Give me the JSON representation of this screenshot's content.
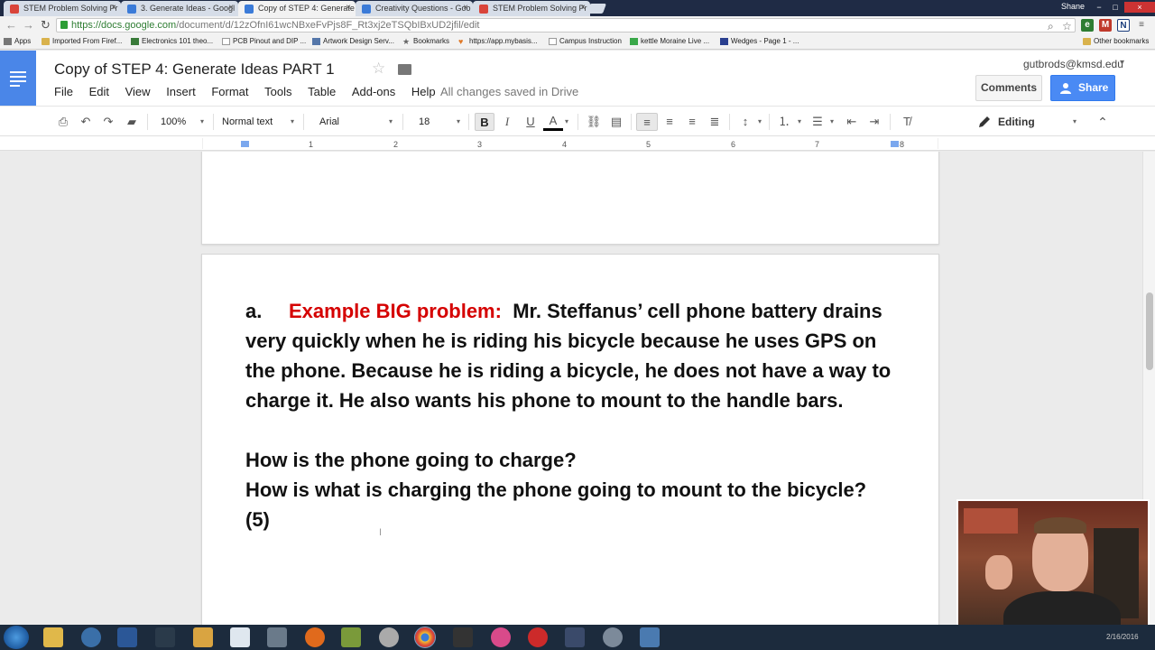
{
  "browser": {
    "tabs": [
      {
        "title": "STEM Problem Solving Pr",
        "active": false
      },
      {
        "title": "3. Generate Ideas - Googl",
        "active": false
      },
      {
        "title": "Copy of STEP 4: Generate",
        "active": true
      },
      {
        "title": "Creativity Questions - Goo",
        "active": false
      },
      {
        "title": "STEM Problem Solving Pr",
        "active": false
      }
    ],
    "profile_name": "Shane",
    "url_host": "https://docs.google.com",
    "url_path": "/document/d/12zOfnI61wcNBxeFvPjs8F_Rt3xj2eTSQbIBxUD2jfil/edit",
    "bookmarks": [
      "Apps",
      "Imported From Firef...",
      "Electronics 101 theo...",
      "PCB Pinout and DIP ...",
      "Artwork Design Serv...",
      "Bookmarks",
      "https://app.mybasis...",
      "Campus Instruction",
      "kettle Moraine Live ...",
      "Wedges - Page 1 - ..."
    ],
    "other_bookmarks": "Other bookmarks"
  },
  "docs": {
    "title": "Copy of STEP 4: Generate Ideas PART 1",
    "menu": [
      "File",
      "Edit",
      "View",
      "Insert",
      "Format",
      "Tools",
      "Table",
      "Add-ons",
      "Help"
    ],
    "save_status": "All changes saved in Drive",
    "user_email": "gutbrods@kmsd.edu",
    "comments_label": "Comments",
    "share_label": "Share",
    "accent_color": "#4a86e8"
  },
  "toolbar": {
    "zoom": "100%",
    "style": "Normal text",
    "font": "Arial",
    "font_size": "18",
    "bold": "B",
    "italic": "I",
    "underline": "U",
    "text_color": "A",
    "mode": "Editing"
  },
  "ruler": {
    "numbers": [
      "1",
      "2",
      "3",
      "4",
      "5",
      "6",
      "7",
      "8"
    ]
  },
  "document": {
    "list_marker": "a.",
    "label_red": "Example BIG problem:",
    "problem_text": "Mr. Steffanus’ cell phone battery drains very quickly when he is riding his bicycle because he uses GPS on the phone.  Because he is riding a bicycle, he does not have a way to charge it.  He also wants his phone to mount to the handle bars.",
    "question_1": "How is the phone going to charge?",
    "question_2": "How is what is charging the phone going to mount to the bicycle? (5)",
    "label_color": "#d50000"
  },
  "taskbar": {
    "time": "2/16/2016"
  }
}
